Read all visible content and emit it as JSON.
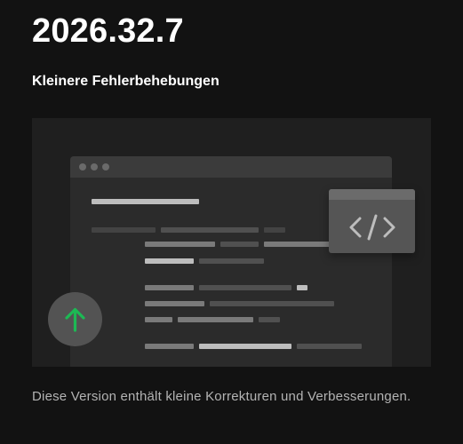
{
  "release": {
    "version": "2026.32.7",
    "subtitle": "Kleinere Fehlerbehebungen",
    "description": "Diese Version enthält kleine Korrekturen und Verbesserungen."
  },
  "illustration": {
    "code_icon": "code-brackets-icon",
    "update_icon": "arrow-up-icon",
    "accent_color": "#1db954"
  }
}
